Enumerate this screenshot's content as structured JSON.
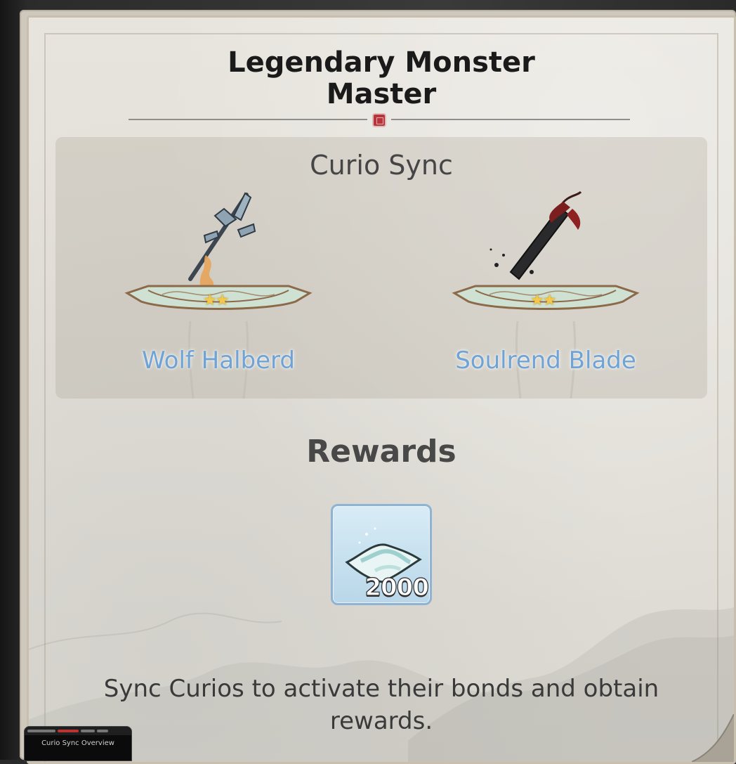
{
  "dialog": {
    "title_line1": "Legendary Monster",
    "title_line2": "Master"
  },
  "curio_sync": {
    "heading": "Curio Sync",
    "items": [
      {
        "label": "Wolf Halberd",
        "stars": 2,
        "icon": "halberd-icon"
      },
      {
        "label": "Soulrend Blade",
        "stars": 2,
        "icon": "dark-blade-icon"
      }
    ]
  },
  "rewards": {
    "heading": "Rewards",
    "items": [
      {
        "icon": "jade-cloth-icon",
        "count": "2000"
      }
    ]
  },
  "hint": {
    "text": "Sync Curios to activate their bonds and obtain rewards."
  },
  "overlay": {
    "title": "Curio Sync Overview"
  },
  "colors": {
    "label_blue": "#6fa3d6",
    "title_text": "#1a1a1a",
    "seal_red": "#b8343a",
    "reward_frame": "#8fb3d3"
  }
}
